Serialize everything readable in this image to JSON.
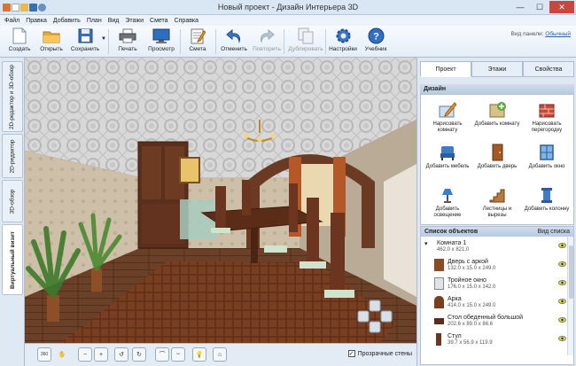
{
  "window": {
    "title": "Новый проект - Дизайн Интерьера 3D"
  },
  "menu": [
    "Файл",
    "Правка",
    "Добавить",
    "План",
    "Вид",
    "Этажи",
    "Смета",
    "Справка"
  ],
  "toolbar": {
    "create": "Создать",
    "open": "Открыть",
    "save": "Сохранить",
    "print": "Печать",
    "preview": "Просмотр",
    "estimate": "Смета",
    "undo": "Отменить",
    "redo": "Повторить",
    "duplicate": "Дублировать",
    "settings": "Настройки",
    "tutorial": "Учебник",
    "panel_view_label": "Вид панели:",
    "panel_view_value": "Обычный"
  },
  "left_tabs": [
    "2D-редактор и 3D-обзор",
    "2D-редактор",
    "3D-обзор",
    "Виртуальный визит"
  ],
  "right_tabs": [
    "Проект",
    "Этажи",
    "Свойства"
  ],
  "design": {
    "title": "Дизайн",
    "buttons": [
      {
        "label": "Нарисовать комнату",
        "icon": "draw-room-icon"
      },
      {
        "label": "Добавить комнату",
        "icon": "add-room-icon"
      },
      {
        "label": "Нарисовать перегородку",
        "icon": "draw-partition-icon"
      },
      {
        "label": "Добавить мебель",
        "icon": "add-furniture-icon"
      },
      {
        "label": "Добавить дверь",
        "icon": "add-door-icon"
      },
      {
        "label": "Добавить окно",
        "icon": "add-window-icon"
      },
      {
        "label": "Добавить освещение",
        "icon": "add-lighting-icon"
      },
      {
        "label": "Лестницы и вырезы",
        "icon": "stairs-icon"
      },
      {
        "label": "Добавить колонну",
        "icon": "add-column-icon"
      }
    ]
  },
  "objects": {
    "title": "Список объектов",
    "view_label": "Вид списка",
    "items": [
      {
        "name": "Комната 1",
        "dims": "462.0 x 821.0"
      },
      {
        "name": "Дверь с аркой",
        "dims": "132.0 x 15.0 x 249.0"
      },
      {
        "name": "Тройное окно",
        "dims": "176.0 x 15.0 x 142.0"
      },
      {
        "name": "Арка",
        "dims": "414.0 x 15.0 x 249.0"
      },
      {
        "name": "Стол обеденный большой",
        "dims": "202.6 x 89.0 x 86.6"
      },
      {
        "name": "Стул",
        "dims": "39.7 x 56.9 x 119.9"
      }
    ]
  },
  "bottombar": {
    "transparent_walls": "Прозрачные стены",
    "checked": true
  }
}
